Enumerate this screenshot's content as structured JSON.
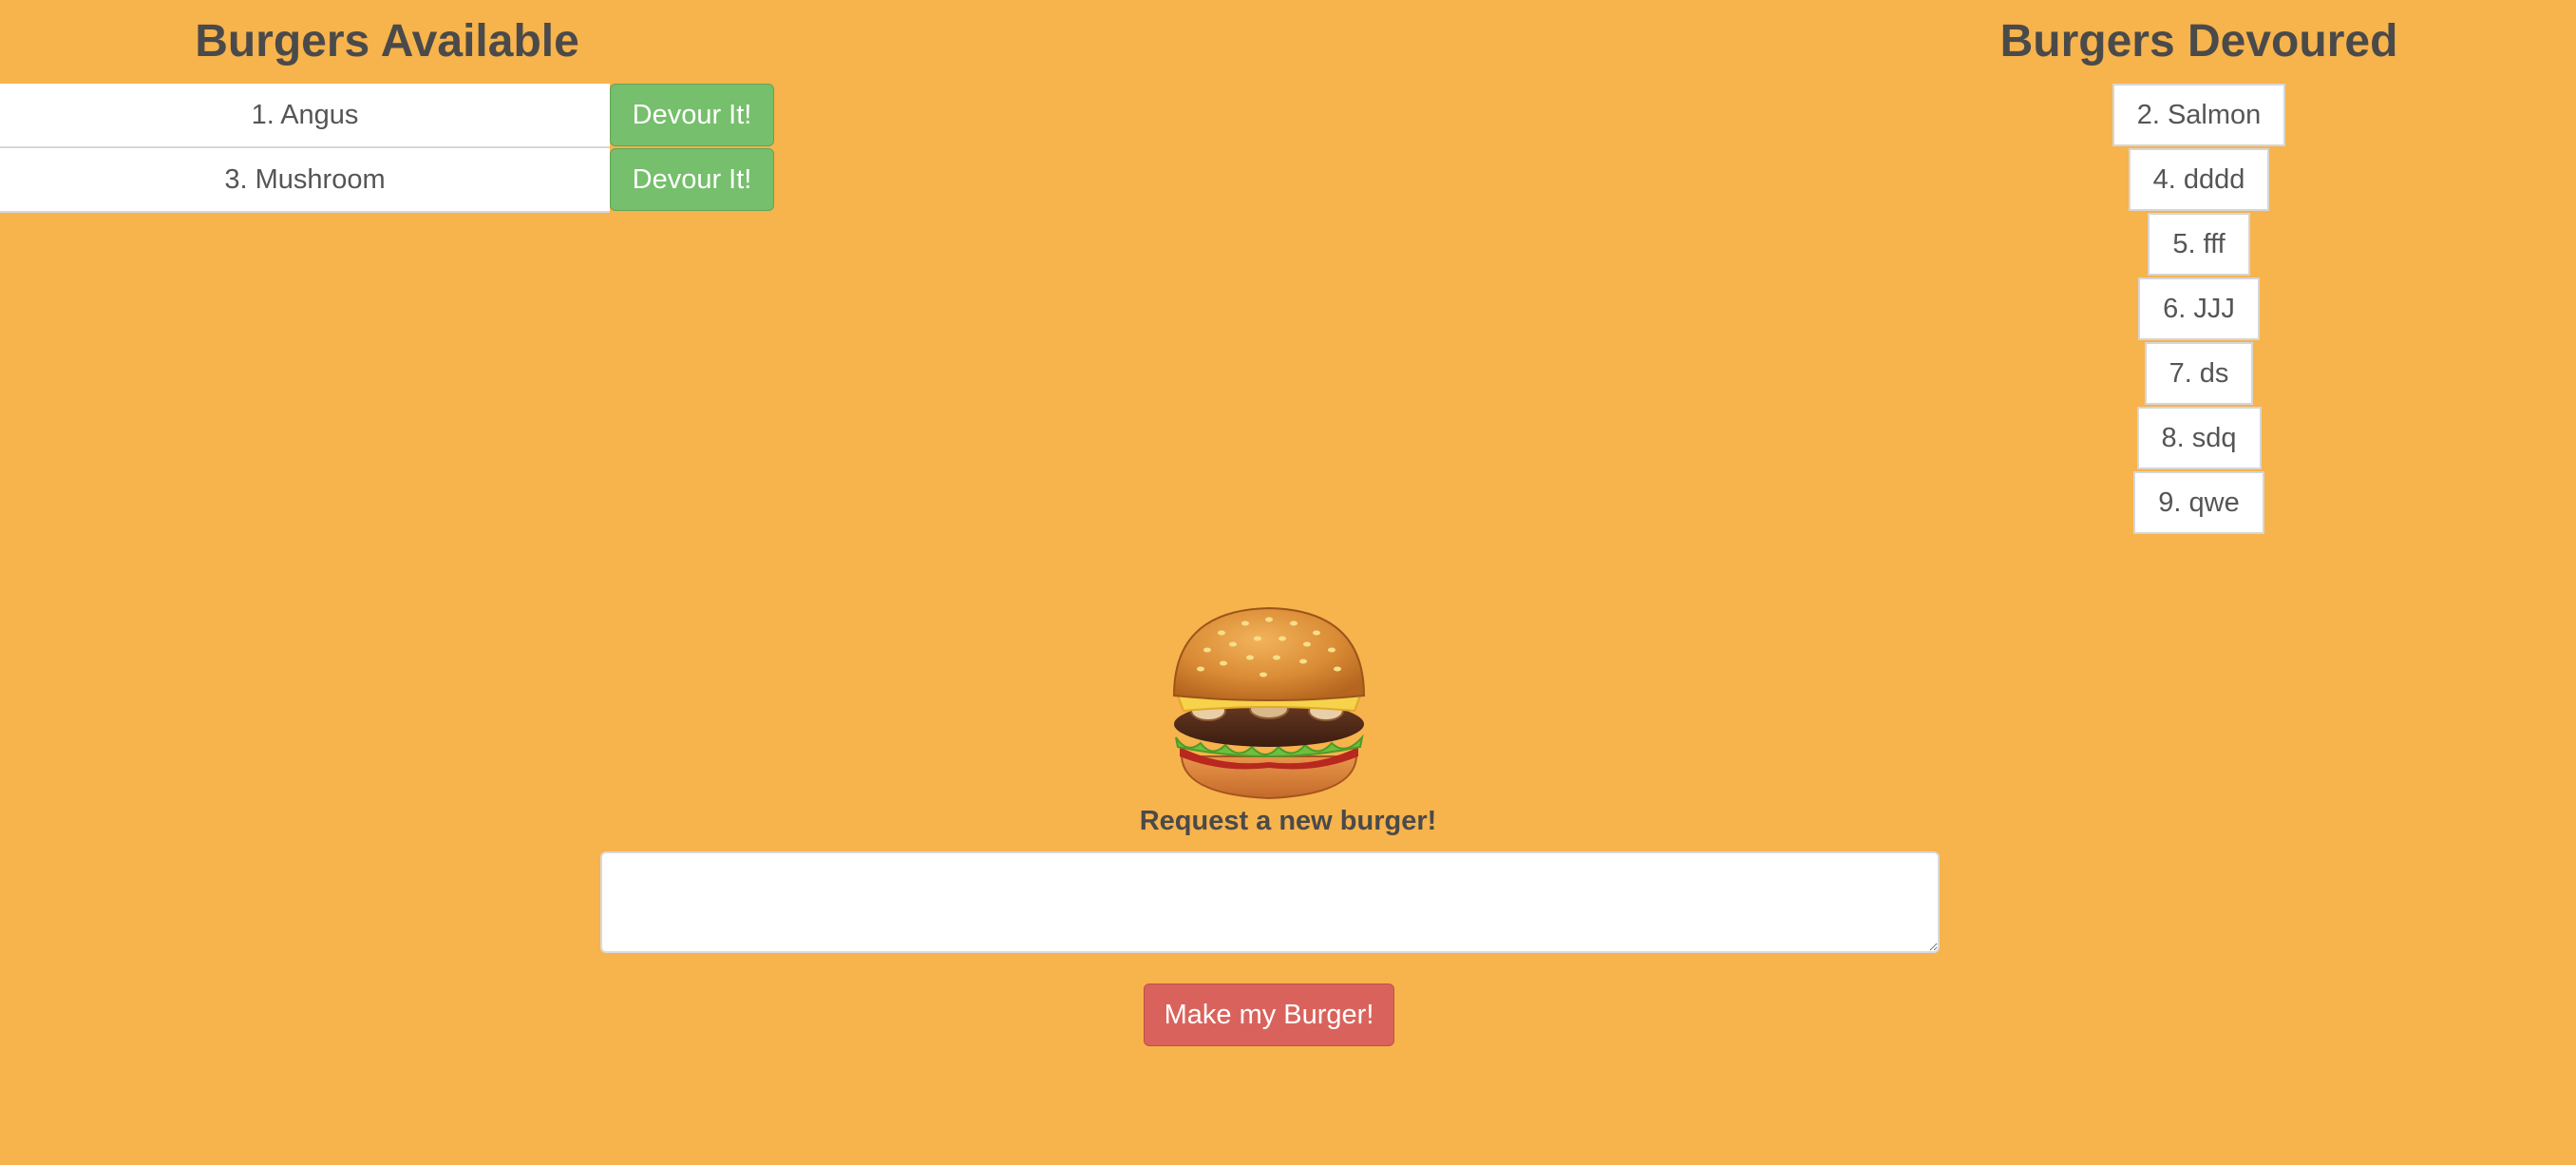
{
  "available": {
    "title": "Burgers Available",
    "button_label": "Devour It!",
    "items": [
      {
        "label": "1. Angus"
      },
      {
        "label": "3. Mushroom"
      }
    ]
  },
  "devoured": {
    "title": "Burgers Devoured",
    "items": [
      {
        "label": "2. Salmon"
      },
      {
        "label": "4. dddd"
      },
      {
        "label": "5. fff"
      },
      {
        "label": "6. JJJ"
      },
      {
        "label": "7. ds"
      },
      {
        "label": "8. sdq"
      },
      {
        "label": "9. qwe"
      }
    ]
  },
  "form": {
    "label": "Request a new burger!",
    "input_value": "",
    "submit_label": "Make my Burger!"
  },
  "theme": {
    "background": "#f7b34c",
    "devour_button": "#76bf6c",
    "make_button": "#d9635c",
    "text": "#4a4a4a"
  },
  "icons": {
    "burger": "burger-icon"
  }
}
